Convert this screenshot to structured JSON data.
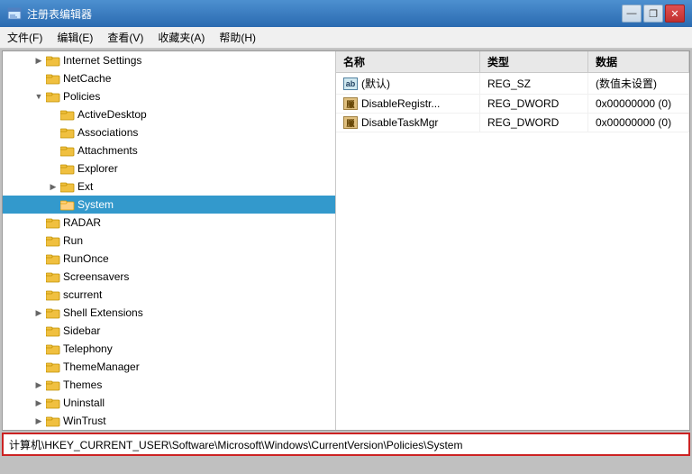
{
  "window": {
    "title": "注册表编辑器",
    "icon": "📋"
  },
  "menu": {
    "items": [
      "文件(F)",
      "编辑(E)",
      "查看(V)",
      "收藏夹(A)",
      "帮助(H)"
    ]
  },
  "tree": {
    "items": [
      {
        "id": "internet-settings",
        "label": "Internet Settings",
        "indent": 2,
        "expandable": true,
        "expanded": false
      },
      {
        "id": "netcache",
        "label": "NetCache",
        "indent": 2,
        "expandable": false,
        "expanded": false
      },
      {
        "id": "policies",
        "label": "Policies",
        "indent": 2,
        "expandable": true,
        "expanded": true
      },
      {
        "id": "activedesktop",
        "label": "ActiveDesktop",
        "indent": 3,
        "expandable": false,
        "expanded": false
      },
      {
        "id": "associations",
        "label": "Associations",
        "indent": 3,
        "expandable": false,
        "expanded": false
      },
      {
        "id": "attachments",
        "label": "Attachments",
        "indent": 3,
        "expandable": false,
        "expanded": false
      },
      {
        "id": "explorer",
        "label": "Explorer",
        "indent": 3,
        "expandable": false,
        "expanded": false
      },
      {
        "id": "ext",
        "label": "Ext",
        "indent": 3,
        "expandable": true,
        "expanded": false
      },
      {
        "id": "system",
        "label": "System",
        "indent": 3,
        "expandable": false,
        "expanded": false,
        "selected": true
      },
      {
        "id": "radar",
        "label": "RADAR",
        "indent": 2,
        "expandable": false,
        "expanded": false
      },
      {
        "id": "run",
        "label": "Run",
        "indent": 2,
        "expandable": false,
        "expanded": false
      },
      {
        "id": "runonce",
        "label": "RunOnce",
        "indent": 2,
        "expandable": false,
        "expanded": false
      },
      {
        "id": "screensavers",
        "label": "Screensavers",
        "indent": 2,
        "expandable": false,
        "expanded": false
      },
      {
        "id": "scurrent",
        "label": "scurrent",
        "indent": 2,
        "expandable": false,
        "expanded": false
      },
      {
        "id": "shell-extensions",
        "label": "Shell Extensions",
        "indent": 2,
        "expandable": true,
        "expanded": false
      },
      {
        "id": "sidebar",
        "label": "Sidebar",
        "indent": 2,
        "expandable": false,
        "expanded": false
      },
      {
        "id": "telephony",
        "label": "Telephony",
        "indent": 2,
        "expandable": false,
        "expanded": false
      },
      {
        "id": "thememanager",
        "label": "ThemeManager",
        "indent": 2,
        "expandable": false,
        "expanded": false
      },
      {
        "id": "themes",
        "label": "Themes",
        "indent": 2,
        "expandable": true,
        "expanded": false
      },
      {
        "id": "uninstall",
        "label": "Uninstall",
        "indent": 2,
        "expandable": true,
        "expanded": false
      },
      {
        "id": "wintrust",
        "label": "WinTrust",
        "indent": 2,
        "expandable": true,
        "expanded": false
      }
    ]
  },
  "table": {
    "headers": [
      "名称",
      "类型",
      "数据"
    ],
    "rows": [
      {
        "name": "(默认)",
        "icon": "ab",
        "type": "REG_SZ",
        "data": "(数值未设置)"
      },
      {
        "name": "DisableRegistr...",
        "icon": "dw",
        "type": "REG_DWORD",
        "data": "0x00000000 (0)"
      },
      {
        "name": "DisableTaskMgr",
        "icon": "dw",
        "type": "REG_DWORD",
        "data": "0x00000000 (0)"
      }
    ]
  },
  "statusbar": {
    "path": "计算机\\HKEY_CURRENT_USER\\Software\\Microsoft\\Windows\\CurrentVersion\\Policies\\System"
  },
  "titleButtons": {
    "minimize": "—",
    "restore": "❐",
    "close": "✕"
  }
}
